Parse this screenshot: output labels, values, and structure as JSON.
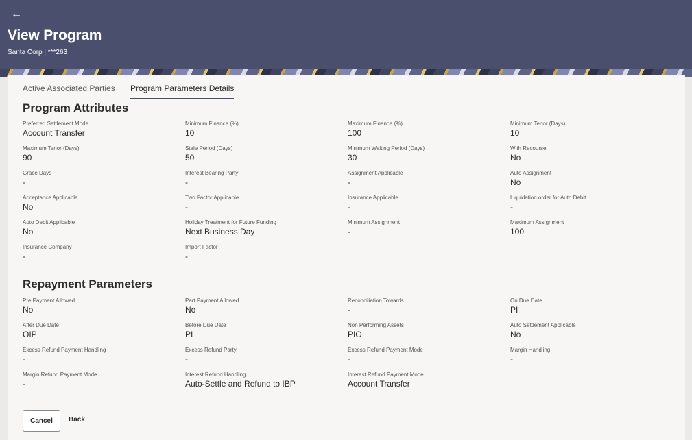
{
  "header": {
    "back_icon": "←",
    "title": "View Program",
    "subtitle": "Santa Corp | ***263"
  },
  "tabs": [
    {
      "label": "Active Associated Parties",
      "active": false
    },
    {
      "label": "Program Parameters Details",
      "active": true
    }
  ],
  "program_attributes": {
    "title": "Program Attributes",
    "fields": [
      {
        "label": "Preferred Settlement Mode",
        "value": "Account Transfer"
      },
      {
        "label": "Minimum Finance (%)",
        "value": "10"
      },
      {
        "label": "Maximum Finance (%)",
        "value": "100"
      },
      {
        "label": "Minimum Tenor (Days)",
        "value": "10"
      },
      {
        "label": "Maximum Tenor (Days)",
        "value": "90"
      },
      {
        "label": "Stale Period (Days)",
        "value": "50"
      },
      {
        "label": "Minimum Waiting Period (Days)",
        "value": "30"
      },
      {
        "label": "With Recourse",
        "value": "No"
      },
      {
        "label": "Grace Days",
        "value": "-"
      },
      {
        "label": "Interest Bearing Party",
        "value": "-"
      },
      {
        "label": "Assignment Applicable",
        "value": "-"
      },
      {
        "label": "Auto Assignment",
        "value": "No"
      },
      {
        "label": "Acceptance Applicable",
        "value": "No"
      },
      {
        "label": "Two Factor Applicable",
        "value": "-"
      },
      {
        "label": "Insurance Applicable",
        "value": "-"
      },
      {
        "label": "Liquidation order for Auto Debit",
        "value": "-"
      },
      {
        "label": "Auto Debit Applicable",
        "value": "No"
      },
      {
        "label": "Holiday Treatment for Future Funding",
        "value": "Next Business Day"
      },
      {
        "label": "Minimum Assignment",
        "value": "-"
      },
      {
        "label": "Maximum Assignment",
        "value": "100"
      },
      {
        "label": "Insurance Company",
        "value": "-"
      },
      {
        "label": "Import Factor",
        "value": "-"
      }
    ]
  },
  "repayment_parameters": {
    "title": "Repayment Parameters",
    "fields": [
      {
        "label": "Pre Payment Allowed",
        "value": "No"
      },
      {
        "label": "Part Payment Allowed",
        "value": "No"
      },
      {
        "label": "Reconciliation Towards",
        "value": "-"
      },
      {
        "label": "On Due Date",
        "value": "PI"
      },
      {
        "label": "After Due Date",
        "value": "OIP"
      },
      {
        "label": "Before Due Date",
        "value": "PI"
      },
      {
        "label": "Non Performing Assets",
        "value": "PIO"
      },
      {
        "label": "Auto Settlement Applicable",
        "value": "No"
      },
      {
        "label": "Excess Refund Payment Handling",
        "value": "-"
      },
      {
        "label": "Excess Refund Party",
        "value": "-"
      },
      {
        "label": "Excess Refund Payment Mode",
        "value": "-"
      },
      {
        "label": "Margin Handling",
        "value": "-"
      },
      {
        "label": "Margin Refund Payment Mode",
        "value": "-"
      },
      {
        "label": "Interest Refund Handling",
        "value": "Auto-Settle and Refund to IBP"
      },
      {
        "label": "Interest Refund Payment Mode",
        "value": "Account Transfer"
      }
    ]
  },
  "actions": {
    "cancel_label": "Cancel",
    "back_label": "Back"
  }
}
